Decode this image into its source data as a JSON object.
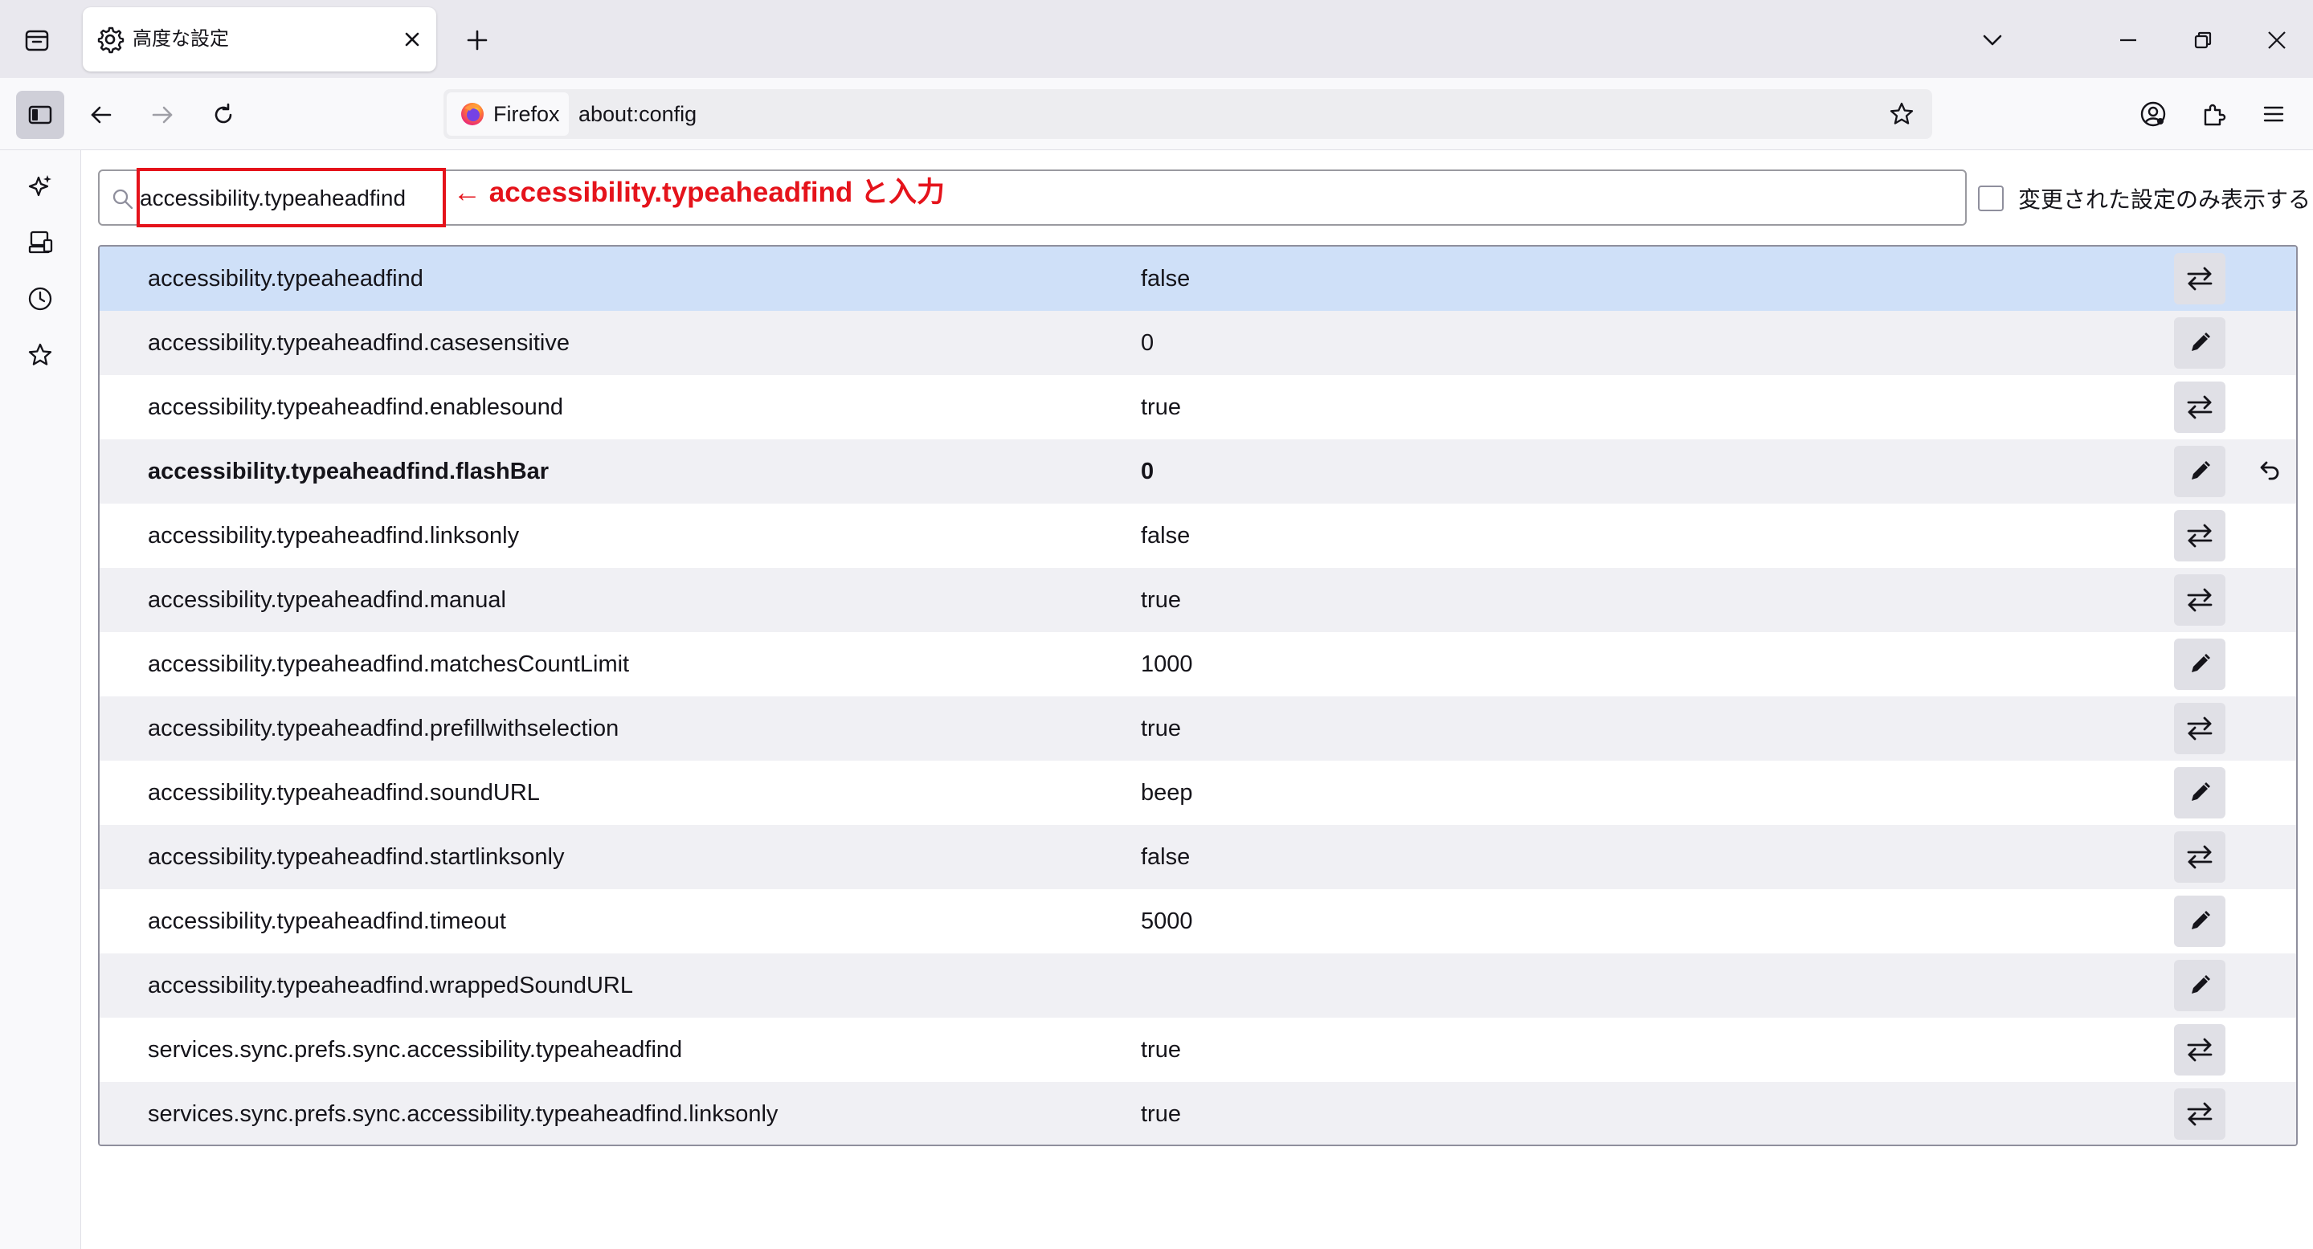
{
  "tab": {
    "title": "高度な設定",
    "icon": "gear-icon"
  },
  "toolbar": {
    "identity_label": "Firefox",
    "url": "about:config"
  },
  "search": {
    "value": "accessibility.typeaheadfind",
    "annotation": "← accessibility.typeaheadfind と入力",
    "annotation_color": "#e5131b"
  },
  "filter": {
    "modified_only_label": "変更された設定のみ表示する",
    "checked": false
  },
  "prefs": [
    {
      "name": "accessibility.typeaheadfind",
      "value": "false",
      "action": "toggle",
      "selected": true,
      "modified": false
    },
    {
      "name": "accessibility.typeaheadfind.casesensitive",
      "value": "0",
      "action": "edit",
      "selected": false,
      "modified": false
    },
    {
      "name": "accessibility.typeaheadfind.enablesound",
      "value": "true",
      "action": "toggle",
      "selected": false,
      "modified": false
    },
    {
      "name": "accessibility.typeaheadfind.flashBar",
      "value": "0",
      "action": "edit",
      "selected": false,
      "modified": true
    },
    {
      "name": "accessibility.typeaheadfind.linksonly",
      "value": "false",
      "action": "toggle",
      "selected": false,
      "modified": false
    },
    {
      "name": "accessibility.typeaheadfind.manual",
      "value": "true",
      "action": "toggle",
      "selected": false,
      "modified": false
    },
    {
      "name": "accessibility.typeaheadfind.matchesCountLimit",
      "value": "1000",
      "action": "edit",
      "selected": false,
      "modified": false
    },
    {
      "name": "accessibility.typeaheadfind.prefillwithselection",
      "value": "true",
      "action": "toggle",
      "selected": false,
      "modified": false
    },
    {
      "name": "accessibility.typeaheadfind.soundURL",
      "value": "beep",
      "action": "edit",
      "selected": false,
      "modified": false
    },
    {
      "name": "accessibility.typeaheadfind.startlinksonly",
      "value": "false",
      "action": "toggle",
      "selected": false,
      "modified": false
    },
    {
      "name": "accessibility.typeaheadfind.timeout",
      "value": "5000",
      "action": "edit",
      "selected": false,
      "modified": false
    },
    {
      "name": "accessibility.typeaheadfind.wrappedSoundURL",
      "value": "",
      "action": "edit",
      "selected": false,
      "modified": false
    },
    {
      "name": "services.sync.prefs.sync.accessibility.typeaheadfind",
      "value": "true",
      "action": "toggle",
      "selected": false,
      "modified": false
    },
    {
      "name": "services.sync.prefs.sync.accessibility.typeaheadfind.linksonly",
      "value": "true",
      "action": "toggle",
      "selected": false,
      "modified": false
    }
  ],
  "colors": {
    "selected_row": "#cfe0f8",
    "alt_row": "#f0f0f4",
    "button_bg": "#e0e0e6"
  }
}
